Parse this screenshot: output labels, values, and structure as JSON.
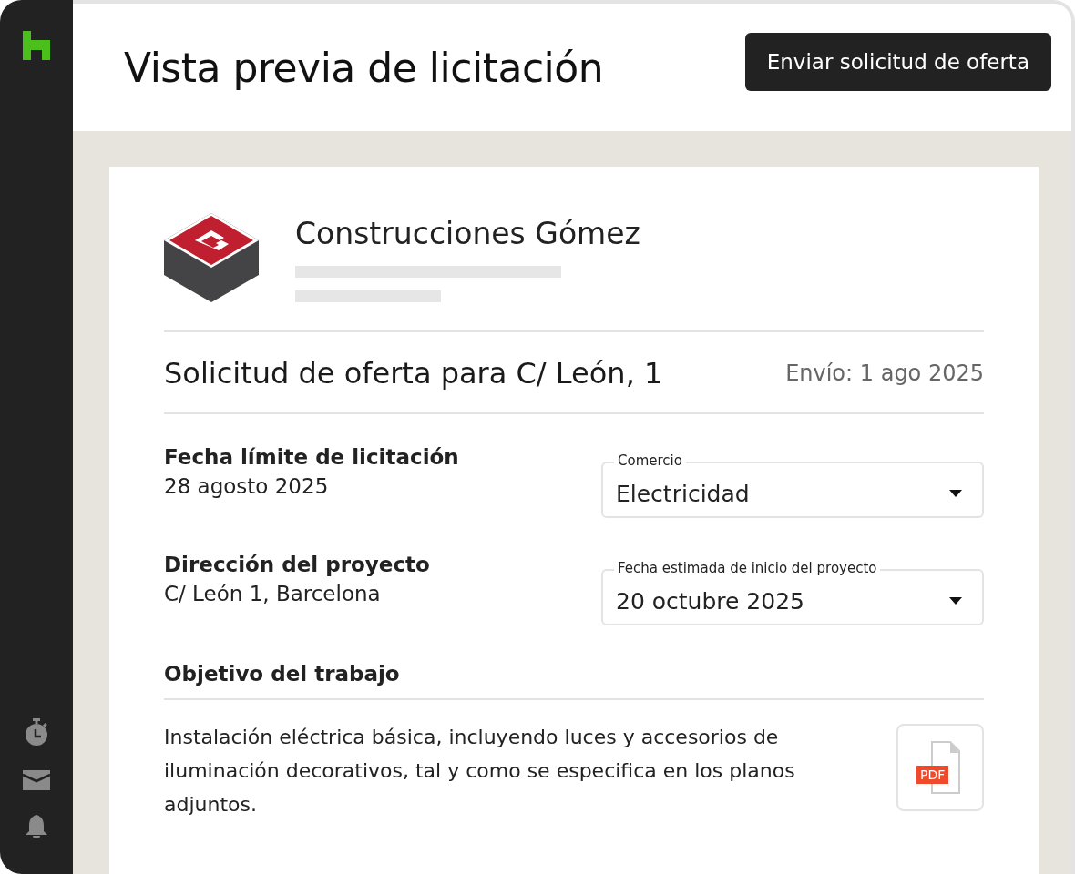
{
  "header": {
    "title": "Vista previa de licitación",
    "action": "Enviar solicitud de oferta"
  },
  "sidebar": {
    "items": [
      {
        "kind": "timer"
      },
      {
        "kind": "mail"
      },
      {
        "kind": "bell"
      }
    ]
  },
  "company": {
    "name": "Construcciones Gómez"
  },
  "request": {
    "title": "Solicitud de oferta para C/ León, 1",
    "sent": "Envío: 1 ago 2025"
  },
  "details": [
    {
      "label": "Fecha límite de licitación",
      "value": "28 agosto 2025"
    },
    {
      "label": "Dirección del proyecto",
      "value": "C/ León 1, Barcelona"
    }
  ],
  "selects": [
    {
      "label": "Comercio",
      "value": "Electricidad"
    },
    {
      "label": "Fecha estimada de inicio del proyecto",
      "value": "20 octubre 2025"
    }
  ],
  "scope": {
    "heading": "Objetivo del trabajo",
    "text": "Instalación eléctrica básica, incluyendo luces y accesorios de iluminación decorativos, tal y como se especifica en los planos adjuntos.",
    "attachment": {
      "badge": "PDF"
    }
  }
}
